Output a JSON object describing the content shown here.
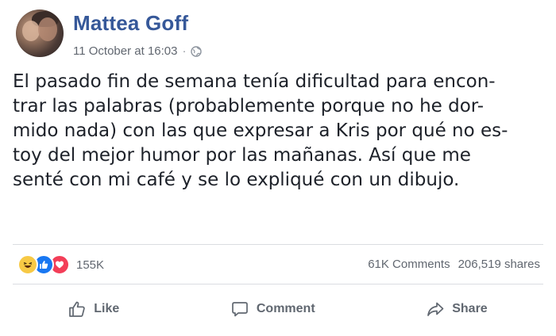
{
  "post": {
    "author": "Mattea Goff",
    "timestamp": "11 October at 16:03",
    "separator": "·",
    "privacy_icon": "globe-icon",
    "text_lines": [
      "El pasado fin de semana tenía dificultad para encon-",
      "trar las palabras (probablemente porque no he dor-",
      "mido nada) con las que expresar a Kris por qué no es-",
      "toy del mejor humor por las mañanas. Así que me",
      "senté con mi café y se lo expliqué con un dibujo."
    ]
  },
  "reactions": {
    "icons": [
      "haha-icon",
      "like-icon",
      "love-icon"
    ],
    "count": "155K"
  },
  "stats": {
    "comments": "61K Comments",
    "shares": "206,519 shares"
  },
  "actions": {
    "like": "Like",
    "comment": "Comment",
    "share": "Share"
  },
  "colors": {
    "author": "#365899",
    "meta": "#616770",
    "text": "#1d2129",
    "action": "#606770",
    "like_reaction": "#1877f2",
    "love_reaction": "#f33e58",
    "haha_reaction": "#f7c945"
  }
}
